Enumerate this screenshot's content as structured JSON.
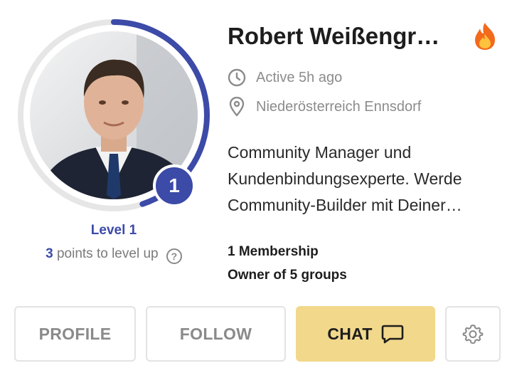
{
  "profile": {
    "name": "Robert Weißengr…",
    "level": {
      "badge": "1",
      "label": "Level 1",
      "points_number": "3",
      "points_text": "points to level up",
      "progress": 0.45
    },
    "active": "Active 5h ago",
    "location": "Niederösterreich Ennsdorf",
    "bio_lines": [
      "Community Manager und",
      "Kundenbindungsexperte. Werde",
      "Community-Builder mit Deiner…"
    ],
    "membership": "1 Membership",
    "owner": "Owner of 5 groups"
  },
  "actions": {
    "profile_label": "PROFILE",
    "follow_label": "FOLLOW",
    "chat_label": "CHAT"
  },
  "icons": {
    "streak": "fire-icon",
    "active": "clock-icon",
    "location": "location-pin-icon",
    "help": "question-circle-icon",
    "chat": "chat-bubble-icon",
    "settings": "gear-icon"
  },
  "colors": {
    "accent": "#3c4aa8",
    "chat_button": "#f2d88b",
    "ring_track": "#e6e6e6"
  }
}
